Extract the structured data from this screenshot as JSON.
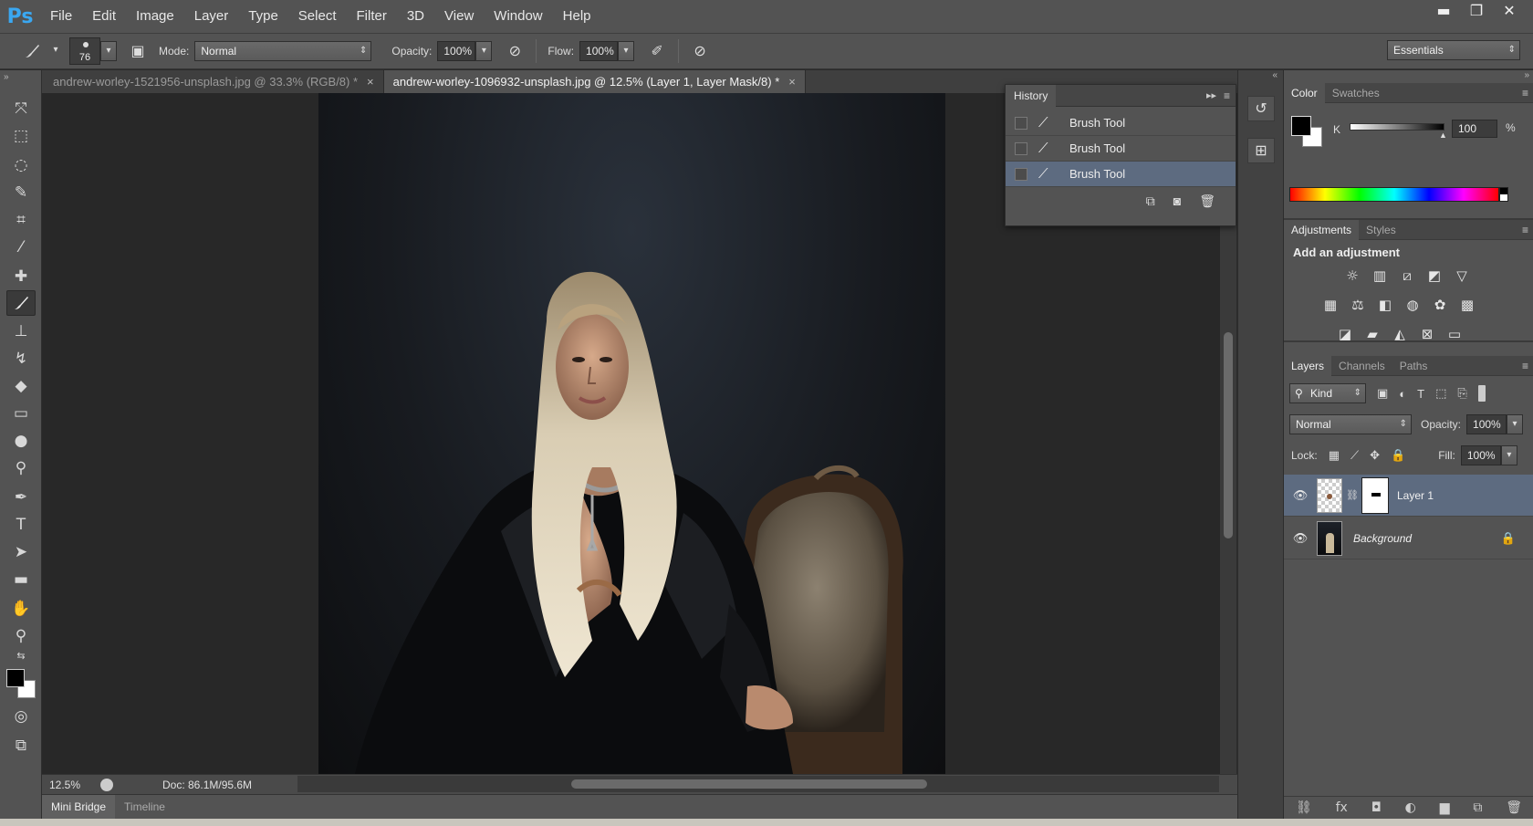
{
  "app": {
    "logo": "Ps",
    "menu": [
      "File",
      "Edit",
      "Image",
      "Layer",
      "Type",
      "Select",
      "Filter",
      "3D",
      "View",
      "Window",
      "Help"
    ],
    "window_controls": {
      "minimize": "▬",
      "restore": "❐",
      "close": "✕"
    }
  },
  "options": {
    "brush_size": "76",
    "mode_label": "Mode:",
    "mode_value": "Normal",
    "opacity_label": "Opacity:",
    "opacity_value": "100%",
    "flow_label": "Flow:",
    "flow_value": "100%",
    "workspace": "Essentials"
  },
  "documents": {
    "tabs": [
      {
        "label": "andrew-worley-1521956-unsplash.jpg @ 33.3% (RGB/8) *",
        "close": "×",
        "active": false
      },
      {
        "label": "andrew-worley-1096932-unsplash.jpg @ 12.5% (Layer 1, Layer Mask/8) *",
        "close": "×",
        "active": true
      }
    ]
  },
  "status": {
    "zoom": "12.5%",
    "doc_size": "Doc: 86.1M/95.6M"
  },
  "bottom_tabs": [
    "Mini Bridge",
    "Timeline"
  ],
  "history": {
    "title": "History",
    "items": [
      "Brush Tool",
      "Brush Tool",
      "Brush Tool"
    ]
  },
  "color_panel": {
    "tabs": [
      "Color",
      "Swatches"
    ],
    "channel_label": "K",
    "channel_value": "100",
    "unit": "%",
    "foreground": "#000000",
    "background": "#ffffff"
  },
  "adjustments_panel": {
    "tabs": [
      "Adjustments",
      "Styles"
    ],
    "title": "Add an adjustment"
  },
  "layers_panel": {
    "tabs": [
      "Layers",
      "Channels",
      "Paths"
    ],
    "filter_kind": "Kind",
    "blend_mode": "Normal",
    "opacity_label": "Opacity:",
    "opacity_value": "100%",
    "lock_label": "Lock:",
    "fill_label": "Fill:",
    "fill_value": "100%",
    "layers": [
      {
        "name": "Layer 1",
        "selected": true,
        "has_mask": true
      },
      {
        "name": "Background",
        "selected": false,
        "locked": true
      }
    ]
  },
  "colors": {
    "accent_selection": "#5d6b80",
    "panel_bg": "#535353",
    "ps_blue": "#3aa7f1"
  }
}
